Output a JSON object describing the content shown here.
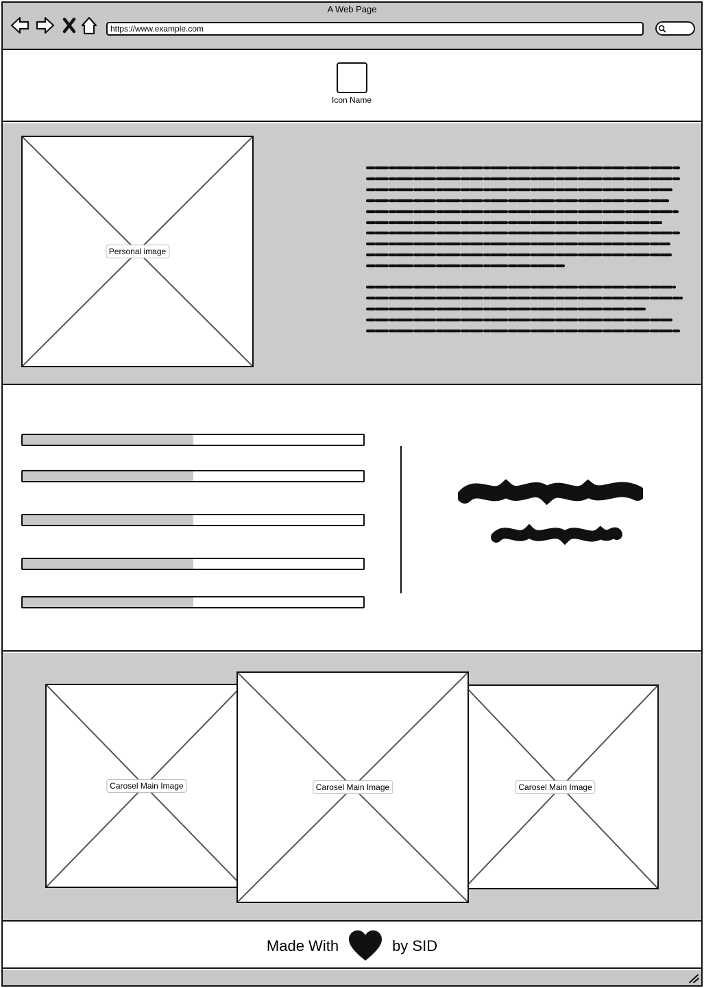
{
  "browser": {
    "window_title": "A Web Page",
    "url": "https://www.example.com",
    "nav_icons": [
      "back-icon",
      "forward-icon",
      "close-icon",
      "home-icon"
    ],
    "search_icon": "search-icon"
  },
  "header": {
    "icon_label": "Icon Name"
  },
  "about": {
    "image_label": "Personal image",
    "paragraph_count": 2
  },
  "skills": {
    "bars": [
      {
        "level": 0.5
      },
      {
        "level": 0.5
      },
      {
        "level": 0.5
      },
      {
        "level": 0.5
      },
      {
        "level": 0.5
      }
    ]
  },
  "carousel": {
    "items": [
      {
        "label": "Carosel Main Image"
      },
      {
        "label": "Carosel Main Image"
      },
      {
        "label": "Carosel Main Image"
      }
    ]
  },
  "footer": {
    "made_with": "Made With",
    "by": "by SID",
    "heart_icon": "heart-icon"
  },
  "colors": {
    "panel_gray": "#cbcbcb",
    "stroke": "#111111",
    "fill_gray": "#c8c8c8"
  }
}
